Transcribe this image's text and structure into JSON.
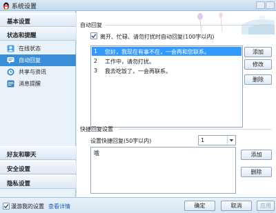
{
  "window": {
    "title": "系统设置"
  },
  "sidebar": {
    "groups": [
      "基本设置",
      "状态和提醒",
      "好友和聊天",
      "安全设置",
      "隐私设置"
    ],
    "items": [
      {
        "label": "在线状态",
        "icon": "online-status-icon"
      },
      {
        "label": "自动回复",
        "icon": "auto-reply-icon",
        "active": true
      },
      {
        "label": "共享与资讯",
        "icon": "share-info-icon"
      },
      {
        "label": "消息提醒",
        "icon": "message-reminder-icon"
      }
    ]
  },
  "auto_reply": {
    "section_title": "自动回复",
    "enable_label": "离开、忙碌、请勿打扰时自动回复(100字以内)",
    "enable_checked": true,
    "items": [
      {
        "num": "1",
        "text": "您好，我现在有事不在，一会再和您联系。",
        "selected": true
      },
      {
        "num": "2",
        "text": "工作中，请勿打扰。"
      },
      {
        "num": "3",
        "text": "我去吃饭了，一会再联系。"
      }
    ],
    "buttons": {
      "add": "添加",
      "edit": "修改",
      "delete": "删除"
    }
  },
  "quick_reply": {
    "section_title": "快捷回复设置",
    "set_label": "设置快捷回复(50字以内)",
    "selected_option": "1",
    "text": "哦",
    "buttons": {
      "add": "添加",
      "delete": "删除"
    }
  },
  "footer": {
    "roam_label": "漫游我的设置",
    "roam_checked": true,
    "details_link": "查看详情",
    "buttons": {
      "ok": "确定",
      "cancel": "取消",
      "apply": "应用"
    }
  },
  "colors": {
    "accent": "#3a8ed8",
    "selection": "#3399ff",
    "link": "#1b5fb6"
  }
}
